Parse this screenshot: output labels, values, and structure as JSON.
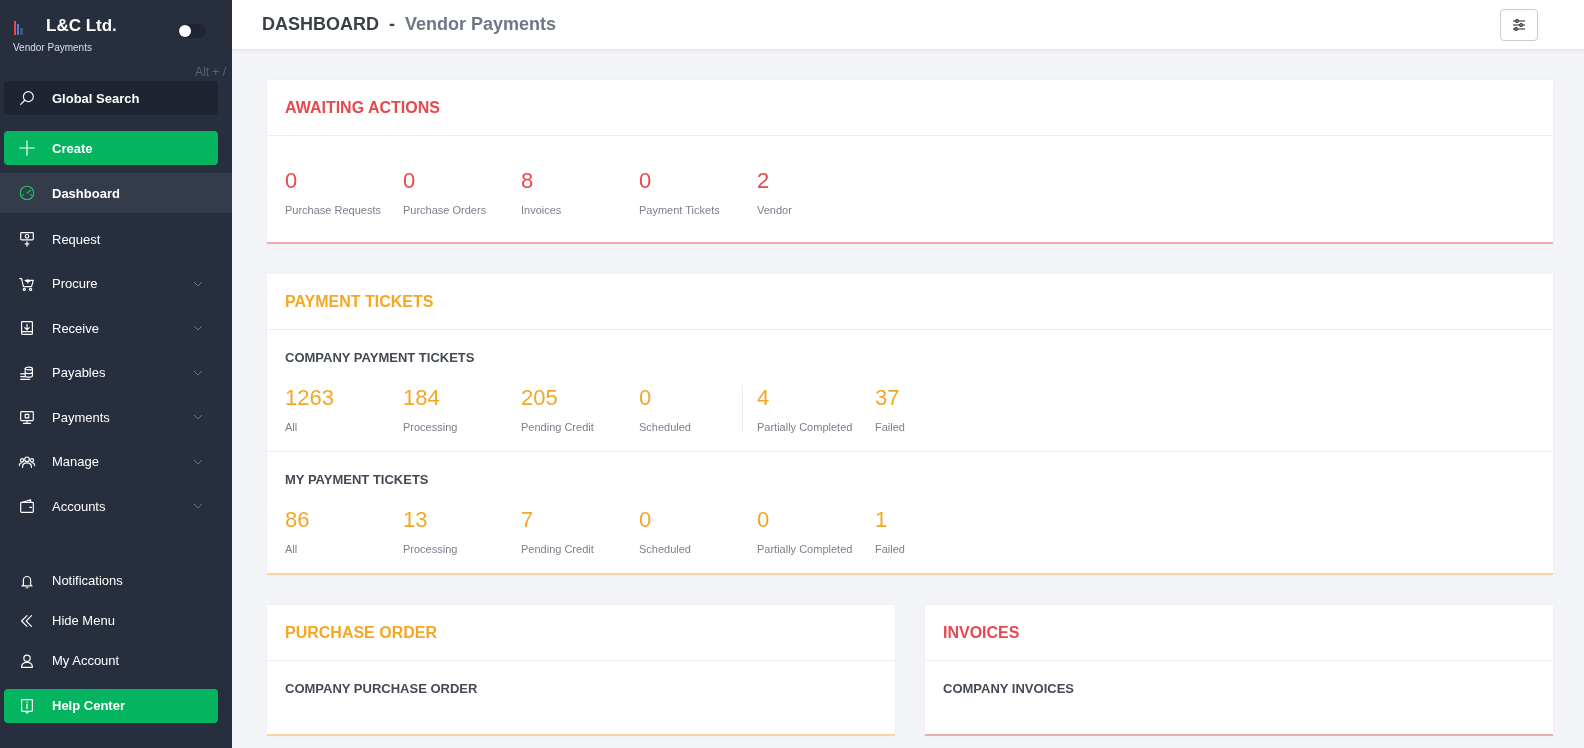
{
  "sidebar": {
    "brand": {
      "name": "L&C Ltd.",
      "subtitle": "Vendor Payments"
    },
    "toggle": {
      "on": false
    },
    "shortcut_hint": "Alt + /",
    "search": {
      "label": "Global Search"
    },
    "create_button": "Create",
    "nav": [
      {
        "label": "Dashboard",
        "selected": true,
        "expandable": false
      },
      {
        "label": "Request",
        "selected": false,
        "expandable": false
      },
      {
        "label": "Procure",
        "selected": false,
        "expandable": true
      },
      {
        "label": "Receive",
        "selected": false,
        "expandable": true
      },
      {
        "label": "Payables",
        "selected": false,
        "expandable": true
      },
      {
        "label": "Payments",
        "selected": false,
        "expandable": true
      },
      {
        "label": "Manage",
        "selected": false,
        "expandable": true
      },
      {
        "label": "Accounts",
        "selected": false,
        "expandable": true
      }
    ],
    "footer": [
      {
        "label": "Notifications"
      },
      {
        "label": "Hide Menu"
      },
      {
        "label": "My Account"
      }
    ],
    "help_button": "Help Center"
  },
  "header": {
    "title": "DASHBOARD",
    "separator": "-",
    "subtitle": "Vendor Payments"
  },
  "awaiting": {
    "title": "AWAITING ACTIONS",
    "color": "#e5484d",
    "stats": [
      {
        "value": "0",
        "label": "Purchase Requests"
      },
      {
        "value": "0",
        "label": "Purchase Orders"
      },
      {
        "value": "8",
        "label": "Invoices"
      },
      {
        "value": "0",
        "label": "Payment Tickets"
      },
      {
        "value": "2",
        "label": "Vendor"
      }
    ]
  },
  "payment_tickets": {
    "title": "PAYMENT TICKETS",
    "color": "#f5a623",
    "groups": [
      {
        "title": "COMPANY PAYMENT TICKETS",
        "stats": [
          {
            "value": "1263",
            "label": "All",
            "divider": false
          },
          {
            "value": "184",
            "label": "Processing",
            "divider": false
          },
          {
            "value": "205",
            "label": "Pending Credit",
            "divider": false
          },
          {
            "value": "0",
            "label": "Scheduled",
            "divider": false
          },
          {
            "value": "4",
            "label": "Partially Completed",
            "divider": true
          },
          {
            "value": "37",
            "label": "Failed",
            "divider": false
          }
        ]
      },
      {
        "title": "MY PAYMENT TICKETS",
        "stats": [
          {
            "value": "86",
            "label": "All",
            "divider": false
          },
          {
            "value": "13",
            "label": "Processing",
            "divider": false
          },
          {
            "value": "7",
            "label": "Pending Credit",
            "divider": false
          },
          {
            "value": "0",
            "label": "Scheduled",
            "divider": false
          },
          {
            "value": "0",
            "label": "Partially Completed",
            "divider": false
          },
          {
            "value": "1",
            "label": "Failed",
            "divider": false
          }
        ]
      }
    ]
  },
  "bottom_cards": [
    {
      "title": "PURCHASE ORDER",
      "color": "#f5a623",
      "subtitle": "COMPANY PURCHASE ORDER"
    },
    {
      "title": "INVOICES",
      "color": "#e5484d",
      "subtitle": "COMPANY INVOICES"
    }
  ]
}
